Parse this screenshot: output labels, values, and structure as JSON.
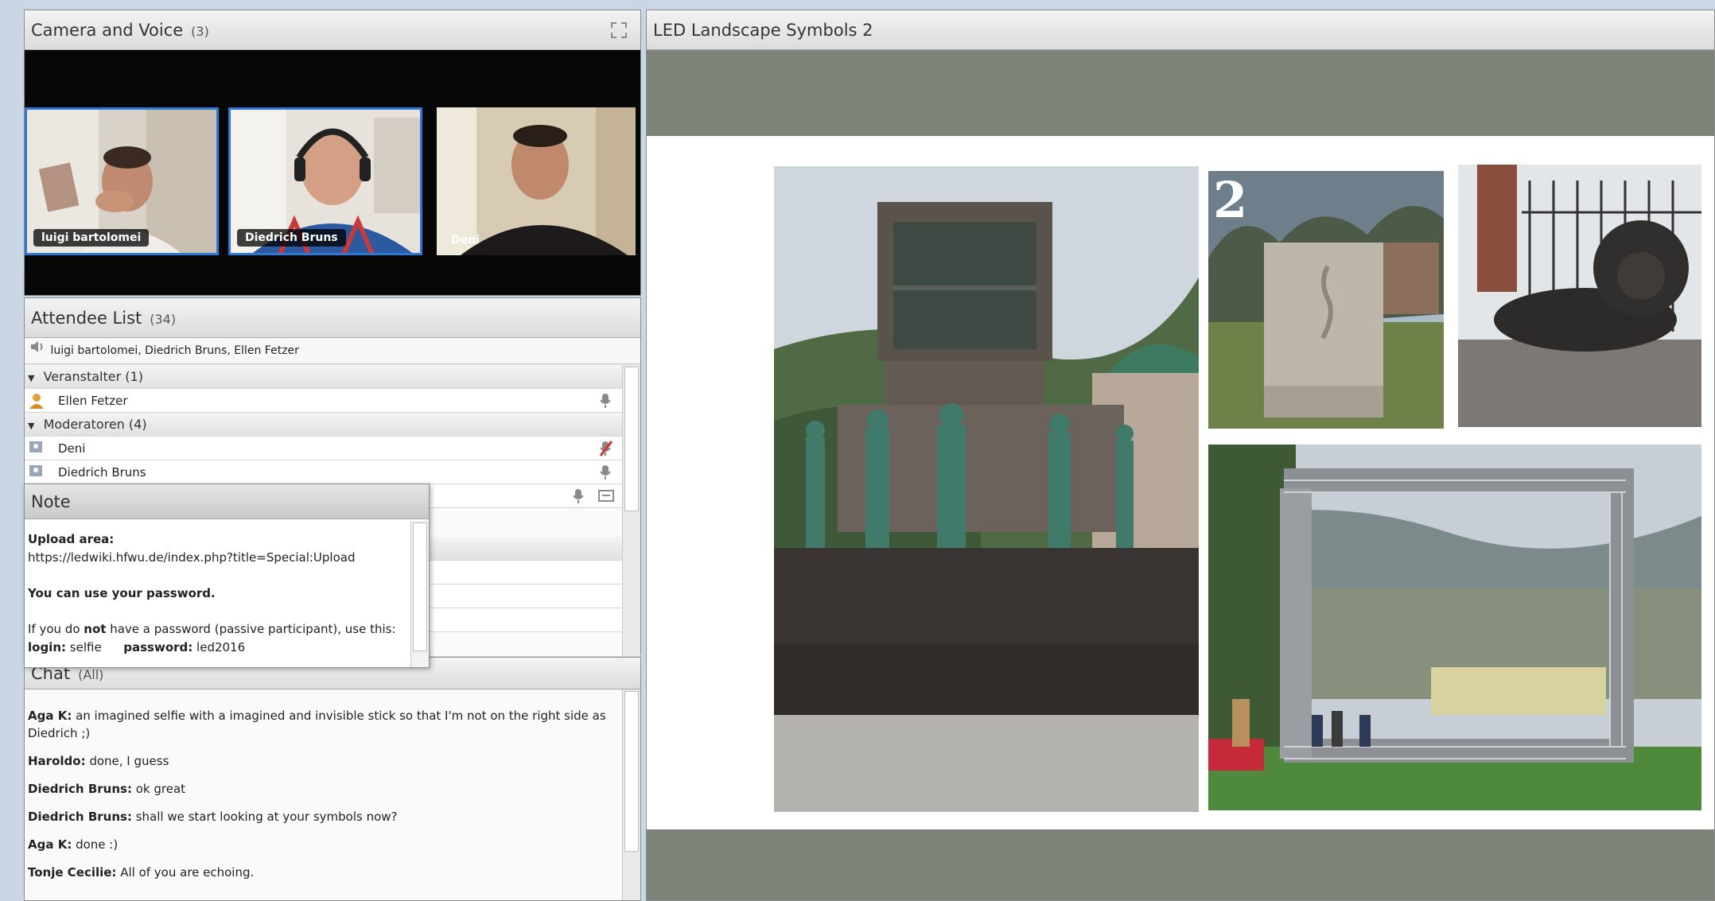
{
  "camera_pod": {
    "title": "Camera and Voice",
    "count": "(3)",
    "tiles": [
      {
        "name": "luigi bartolomei"
      },
      {
        "name": "Diedrich Bruns"
      },
      {
        "name": "Deni"
      }
    ]
  },
  "attendee_pod": {
    "title": "Attendee List",
    "count": "(34)",
    "speakers": "luigi bartolomei, Diedrich Bruns, Ellen Fetzer",
    "groups": [
      {
        "label": "Veranstalter (1)",
        "members": [
          {
            "name": "Ellen Fetzer"
          }
        ]
      },
      {
        "label": "Moderatoren (4)",
        "members": [
          {
            "name": "Deni"
          },
          {
            "name": "Diedrich Bruns"
          }
        ]
      }
    ]
  },
  "note_pod": {
    "title": "Note",
    "upload_label": "Upload area:",
    "upload_url": "https://ledwiki.hfwu.de/index.php?title=Special:Upload",
    "password_line": "You can use your password.",
    "passive_prefix": "If you do ",
    "passive_bold": "not",
    "passive_suffix": " have a password (passive participant), use this:",
    "login_label": "login:",
    "login_value": "selfie",
    "password_label": "password:",
    "password_value": "led2016"
  },
  "chat_pod": {
    "title": "Chat",
    "count": "(All)",
    "messages": [
      {
        "sender": "Aga K:",
        "text": " an imagined selfie with a imagined and invisible stick so that I'm not on the right side as Diedrich ;)"
      },
      {
        "sender": "Haroldo:",
        "text": " done, I guess"
      },
      {
        "sender": "Diedrich Bruns:",
        "text": " ok great"
      },
      {
        "sender": "Diedrich Bruns:",
        "text": " shall we start looking at your symbols now?"
      },
      {
        "sender": "Aga K:",
        "text": " done :)"
      },
      {
        "sender": "Tonje Cecilie:",
        "text": " All of you are echoing."
      }
    ]
  },
  "share_pod": {
    "title": "LED Landscape Symbols 2",
    "photo_number": "2"
  },
  "icons": {
    "fullscreen": "fullscreen-icon",
    "speakers": "speaker-icon",
    "host": "host-user-icon",
    "presenter": "presenter-user-icon",
    "mic": "microphone-icon",
    "mic_off": "microphone-off-icon"
  },
  "colors": {
    "accent": "#2f79d6",
    "pod_header": "#dcdcdc",
    "share_band": "#7c8378"
  }
}
